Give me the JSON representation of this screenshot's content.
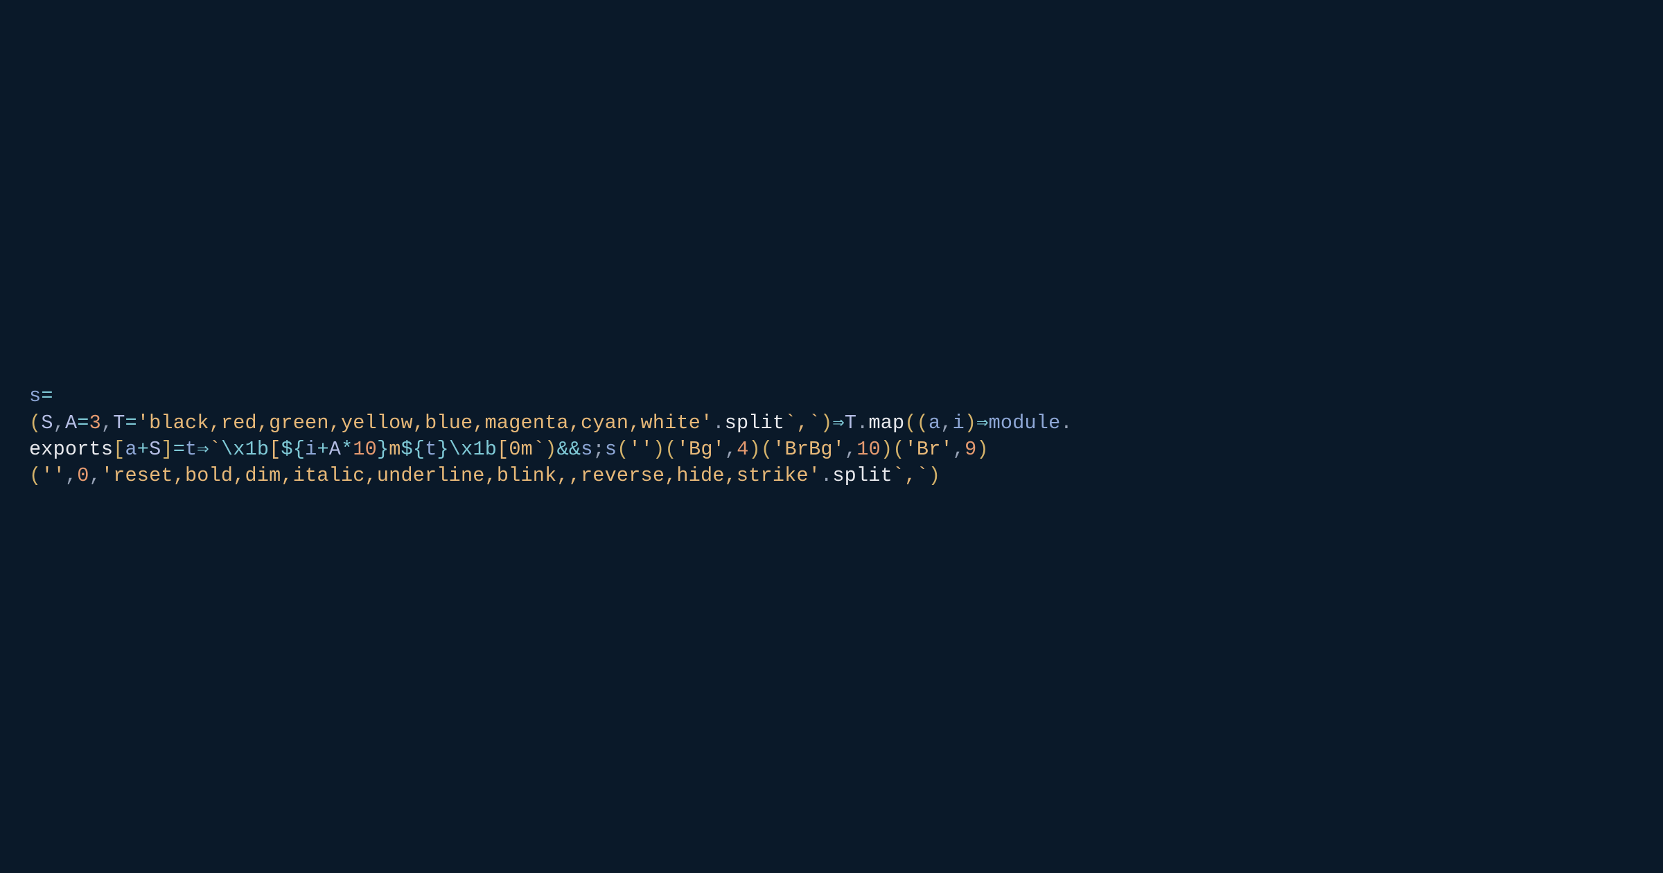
{
  "code": {
    "line1": {
      "var_s": "s",
      "eq": "="
    },
    "line2": {
      "open_paren": "(",
      "S": "S",
      "comma1": ",",
      "A": "A",
      "eq1": "=",
      "num3": "3",
      "comma2": ",",
      "T": "T",
      "eq2": "=",
      "q1": "'",
      "str_colors": "black,red,green,yellow,blue,magenta,cyan,white",
      "q2": "'",
      "dot1": ".",
      "split1": "split",
      "bt1": "`",
      "bt_comma1": ",",
      "bt2": "`",
      "close_paren1": ")",
      "arrow1": "⇒",
      "T2": "T",
      "dot2": ".",
      "map": "map",
      "open_paren2": "(",
      "open_paren3": "(",
      "a": "a",
      "comma3": ",",
      "i": "i",
      "close_paren2": ")",
      "arrow2": "⇒",
      "module": "module",
      "dot3": "."
    },
    "line3": {
      "exports": "exports",
      "lbracket": "[",
      "a": "a",
      "plus": "+",
      "S": "S",
      "rbracket": "]",
      "eq": "=",
      "t": "t",
      "arrow": "⇒",
      "bt1": "`",
      "esc1": "\\x1b",
      "literal1": "[",
      "tmpl_open1": "${",
      "i": "i",
      "plus2": "+",
      "A": "A",
      "star": "*",
      "ten": "10",
      "tmpl_close1": "}",
      "literal_m": "m",
      "tmpl_open2": "${",
      "t2": "t",
      "tmpl_close2": "}",
      "esc2": "\\x1b",
      "literal2": "[0m",
      "bt2": "`",
      "close_paren1": ")",
      "ampamp": "&&",
      "s": "s",
      "semi": ";",
      "s2": "s",
      "open_p1": "(",
      "q1a": "'",
      "q1b": "'",
      "close_p1": ")",
      "open_p2": "(",
      "q2a": "'",
      "str_Bg": "Bg",
      "q2b": "'",
      "comma_a": ",",
      "num4": "4",
      "close_p2": ")",
      "open_p3": "(",
      "q3a": "'",
      "str_BrBg": "BrBg",
      "q3b": "'",
      "comma_b": ",",
      "num10": "10",
      "close_p3": ")",
      "open_p4": "(",
      "q4a": "'",
      "str_Br": "Br",
      "q4b": "'",
      "comma_c": ",",
      "num9": "9",
      "close_p4": ")"
    },
    "line4": {
      "open_p": "(",
      "q1a": "'",
      "q1b": "'",
      "comma1": ",",
      "num0": "0",
      "comma2": ",",
      "q2a": "'",
      "str_modes": "reset,bold,dim,italic,underline,blink,,reverse,hide,strike",
      "q2b": "'",
      "dot": ".",
      "split": "split",
      "bt1": "`",
      "bt_comma": ",",
      "bt2": "`",
      "close_p": ")"
    }
  }
}
